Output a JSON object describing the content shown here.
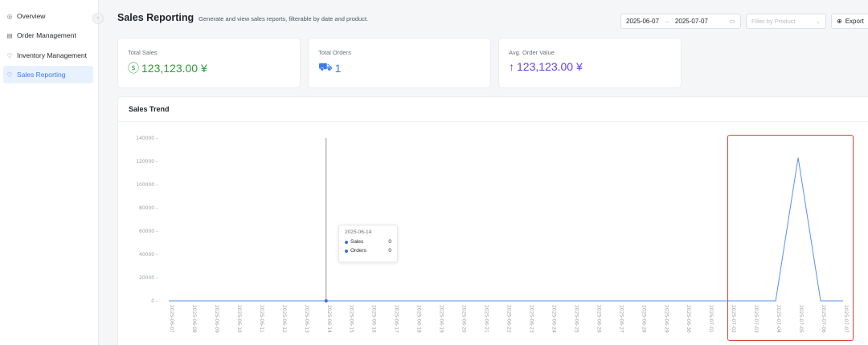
{
  "sidebar": {
    "items": [
      {
        "label": "Overview",
        "icon": "circle-dot-icon",
        "active": false
      },
      {
        "label": "Order Management",
        "icon": "list-icon",
        "active": false
      },
      {
        "label": "Inventory Management",
        "icon": "heart-icon",
        "active": false
      },
      {
        "label": "Sales Reporting",
        "icon": "heart-icon",
        "active": true
      }
    ],
    "collapse_icon": "chevron-left-icon"
  },
  "header": {
    "title": "Sales Reporting",
    "description": "Generate and view sales reports, filterable by date and product."
  },
  "toolbar": {
    "date_start": "2025-06-07",
    "date_separator": "→",
    "date_end": "2025-07-07",
    "product_placeholder": "Filter by Product",
    "export_label": "Export"
  },
  "stats": [
    {
      "label": "Total Sales",
      "value": "123,123.00 ¥",
      "icon": "dollar-circle-icon",
      "color": "#2e9a3b"
    },
    {
      "label": "Total Orders",
      "value": "1",
      "icon": "cart-icon",
      "color": "#3a7bf0"
    },
    {
      "label": "Avg. Order Value",
      "value": "123,123.00 ¥",
      "icon": "arrow-up-icon",
      "color": "#6b3fd4"
    }
  ],
  "trend": {
    "title": "Sales Trend"
  },
  "tooltip": {
    "date": "2025-06-14",
    "rows": [
      {
        "label": "Sales",
        "value": "0",
        "color": "#3a6ee8"
      },
      {
        "label": "Orders",
        "value": "0",
        "color": "#3a6ee8"
      }
    ]
  },
  "chart_data": {
    "type": "line",
    "x": [
      "2025-06-07",
      "2025-06-08",
      "2025-06-09",
      "2025-06-10",
      "2025-06-11",
      "2025-06-12",
      "2025-06-13",
      "2025-06-14",
      "2025-06-15",
      "2025-06-16",
      "2025-06-17",
      "2025-06-18",
      "2025-06-19",
      "2025-06-20",
      "2025-06-21",
      "2025-06-22",
      "2025-06-23",
      "2025-06-24",
      "2025-06-25",
      "2025-06-26",
      "2025-06-27",
      "2025-06-28",
      "2025-06-29",
      "2025-06-30",
      "2025-07-01",
      "2025-07-02",
      "2025-07-03",
      "2025-07-04",
      "2025-07-05",
      "2025-07-06",
      "2025-07-07"
    ],
    "series": [
      {
        "name": "Sales",
        "values": [
          0,
          0,
          0,
          0,
          0,
          0,
          0,
          0,
          0,
          0,
          0,
          0,
          0,
          0,
          0,
          0,
          0,
          0,
          0,
          0,
          0,
          0,
          0,
          0,
          0,
          0,
          0,
          0,
          123123,
          0,
          0
        ],
        "color": "#5b8ff0"
      }
    ],
    "yticks": [
      "0",
      "20000",
      "40000",
      "60000",
      "80000",
      "100000",
      "120000",
      "140000"
    ],
    "ylim": [
      0,
      140000
    ],
    "grid": false,
    "hover_index": 7
  }
}
